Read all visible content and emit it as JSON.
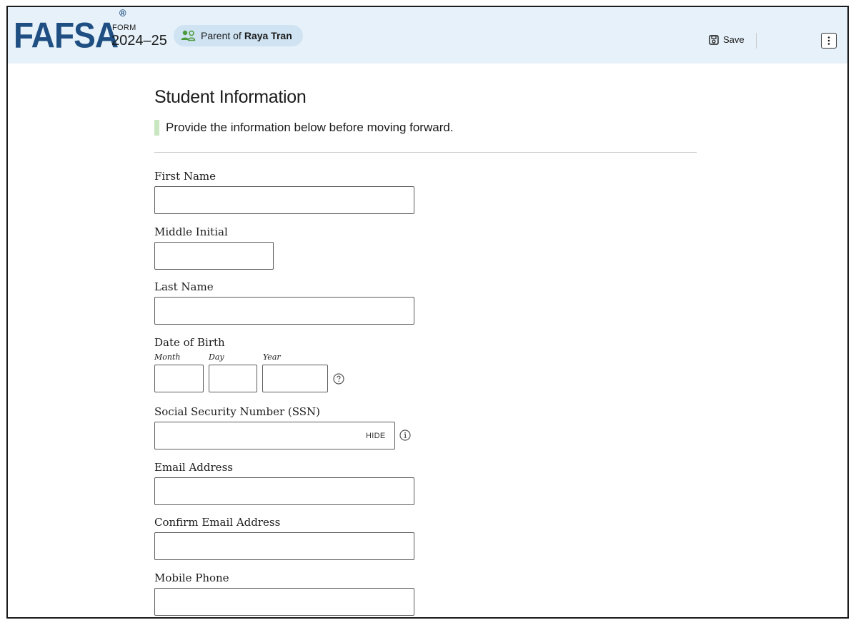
{
  "header": {
    "logo": "FAFSA",
    "logo_mark": "®",
    "form_label": "FORM",
    "form_year": "2024–25",
    "role_prefix": "Parent of",
    "role_name": "Raya Tran",
    "save_label": "Save",
    "icons": {
      "role": "parent-users-icon",
      "save": "floppy-disk-icon",
      "menu": "kebab-menu-icon"
    }
  },
  "page": {
    "title": "Student Information",
    "notice": "Provide the information below before moving forward."
  },
  "fields": {
    "first_name": {
      "label": "First Name",
      "value": ""
    },
    "middle_initial": {
      "label": "Middle Initial",
      "value": ""
    },
    "last_name": {
      "label": "Last Name",
      "value": ""
    },
    "dob": {
      "label": "Date of Birth",
      "month_label": "Month",
      "day_label": "Day",
      "year_label": "Year",
      "month": "",
      "day": "",
      "year": "",
      "help_icon": "question-circle-icon"
    },
    "ssn": {
      "label": "Social Security Number (SSN)",
      "value": "",
      "toggle_label": "HIDE",
      "info_icon": "info-circle-icon"
    },
    "email": {
      "label": "Email Address",
      "value": ""
    },
    "confirm_email": {
      "label": "Confirm Email Address",
      "value": ""
    },
    "mobile_phone": {
      "label": "Mobile Phone",
      "value": ""
    }
  },
  "colors": {
    "header_bg": "#e6f1f9",
    "logo": "#1f4f82",
    "pill_bg": "#cfe3f2",
    "pill_icon": "#4a9a3c",
    "notice_bar": "#c8e6c0"
  }
}
